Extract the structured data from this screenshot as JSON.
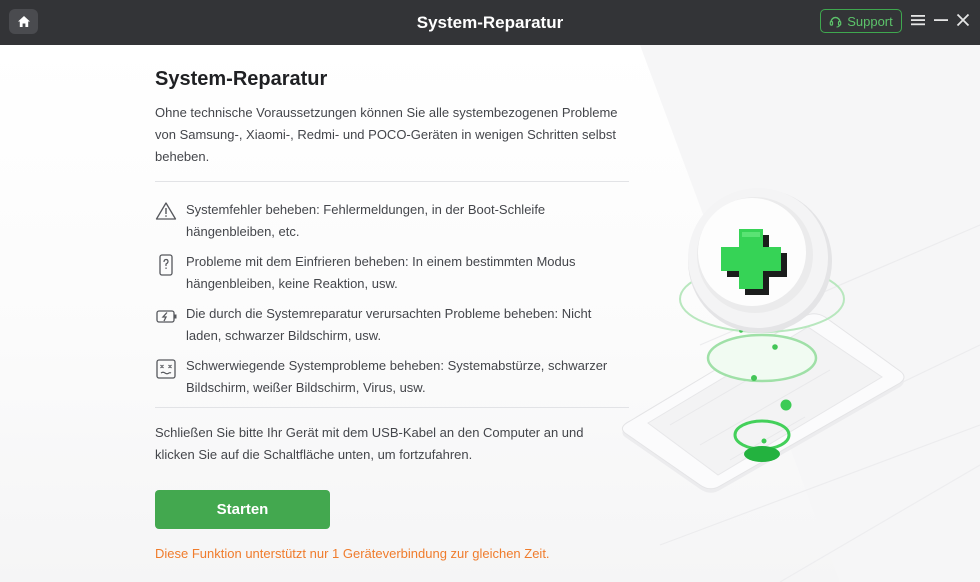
{
  "window": {
    "title": "System-Reparatur",
    "support_label": "Support"
  },
  "icons": {
    "home": "home-icon",
    "support": "headset-icon",
    "menu": "hamburger-menu-icon",
    "minimize": "minimize-icon",
    "close": "close-icon",
    "feature_icons": [
      "warning-triangle-icon",
      "phone-question-icon",
      "battery-charging-icon",
      "broken-screen-icon"
    ]
  },
  "main": {
    "heading": "System-Reparatur",
    "intro": "Ohne technische Voraussetzungen können Sie alle systembezogenen Probleme von Samsung-, Xiaomi-, Redmi- und POCO-Geräten in wenigen Schritten selbst beheben.",
    "features": [
      {
        "text": "Systemfehler beheben: Fehlermeldungen, in der Boot-Schleife hängenbleiben, etc."
      },
      {
        "text": "Probleme mit dem Einfrieren beheben: In einem bestimmten Modus hängenbleiben, keine Reaktion, usw."
      },
      {
        "text": "Die durch die Systemreparatur verursachten Probleme beheben: Nicht laden, schwarzer Bildschirm, usw."
      },
      {
        "text": "Schwerwiegende Systemprobleme beheben: Systemabstürze, schwarzer Bildschirm, weißer Bildschirm, Virus, usw."
      }
    ],
    "instruction": "Schließen Sie bitte Ihr Gerät mit dem USB-Kabel an den Computer an und klicken Sie auf die Schaltfläche unten, um fortzufahren.",
    "start_label": "Starten",
    "note": "Diese Funktion unterstützt nur 1 Geräteverbindung zur gleichen Zeit."
  },
  "colors": {
    "titlebar": "#333437",
    "accent_green": "#43a84f",
    "note_orange": "#f07c2c"
  }
}
